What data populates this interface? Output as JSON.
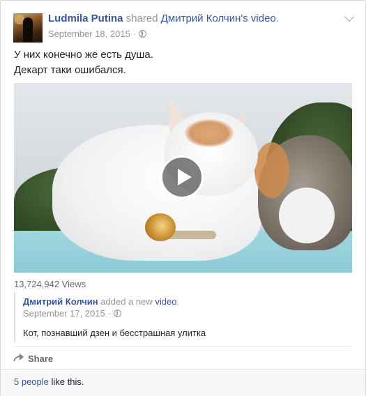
{
  "post": {
    "author": "Ludmila Putina",
    "shared_word": "shared",
    "original_author_possessive": "Дмитрий Колчин's",
    "video_word": "video",
    "period": ".",
    "date": "September 18, 2015",
    "dot": "·",
    "privacy_icon": "globe-icon",
    "text_line1": "У них конечно же есть душа.",
    "text_line2": "Декарт таки ошибался."
  },
  "video": {
    "views": "13,724,942 Views",
    "play_icon": "play-icon"
  },
  "shared_post": {
    "author": "Дмитрий Колчин",
    "action_prefix": "added a new",
    "action_link": "video",
    "period": ".",
    "date": "September 17, 2015",
    "dot": "·",
    "description": "Кот, познавший дзен и бесстрашная улитка"
  },
  "actions": {
    "share_label": "Share",
    "share_icon": "share-icon"
  },
  "likes": {
    "count_link": "5 people",
    "suffix": " like this."
  },
  "colors": {
    "link": "#365899",
    "meta": "#90949c",
    "background": "#e9ebee"
  }
}
